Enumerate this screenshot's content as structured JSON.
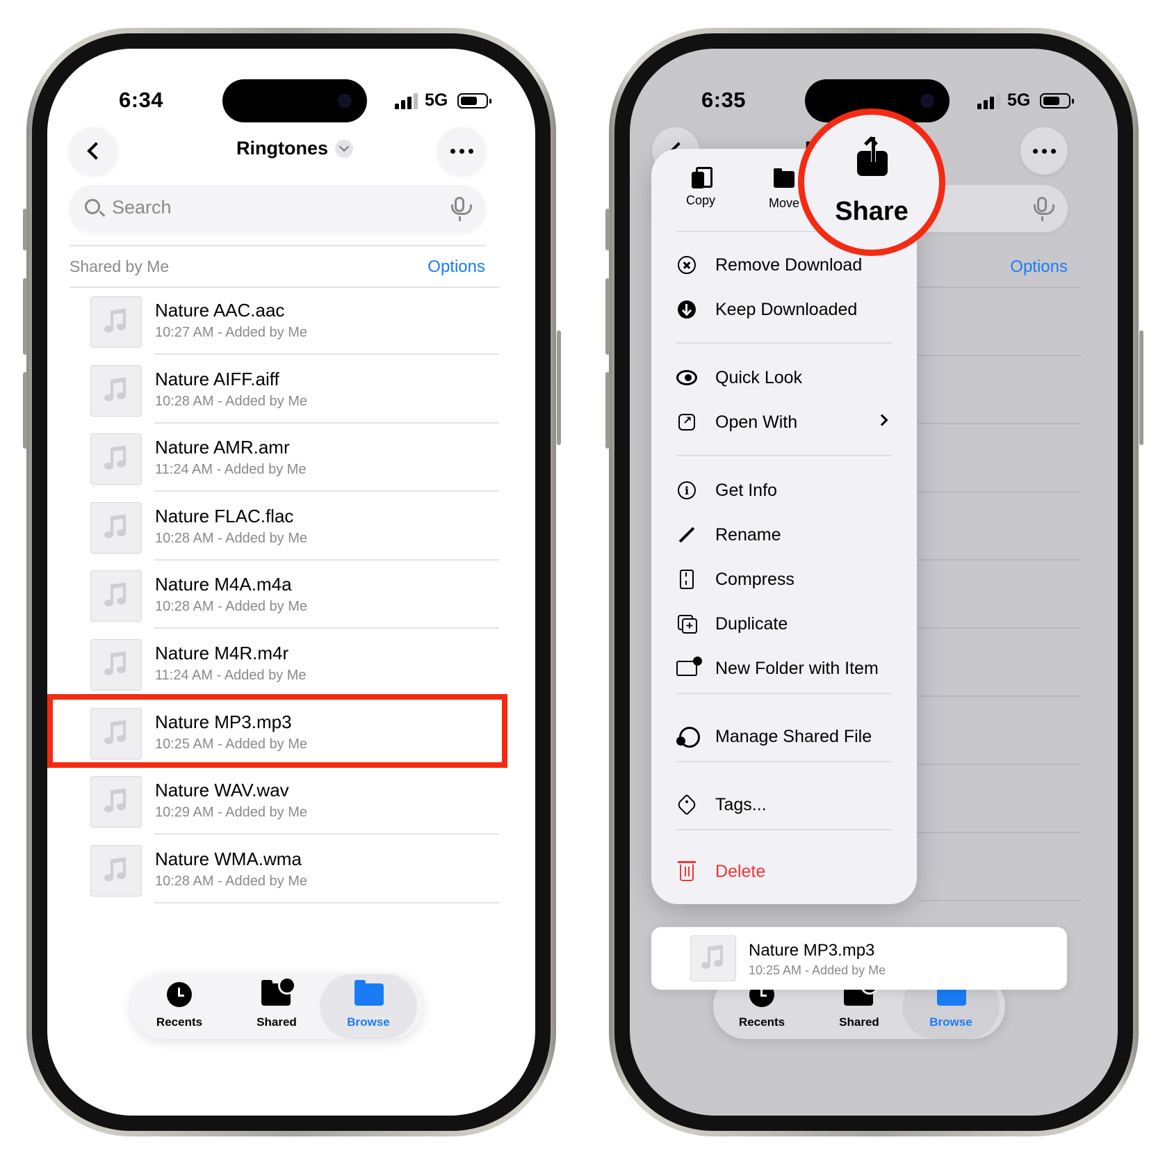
{
  "left": {
    "status": {
      "time": "6:34",
      "network": "5G"
    },
    "header": {
      "title": "Ringtones"
    },
    "search": {
      "placeholder": "Search"
    },
    "section": {
      "label": "Shared by Me",
      "options": "Options"
    },
    "files": [
      {
        "name": "Nature AAC.aac",
        "meta": "10:27 AM - Added by Me"
      },
      {
        "name": "Nature AIFF.aiff",
        "meta": "10:28 AM - Added by Me"
      },
      {
        "name": "Nature AMR.amr",
        "meta": "11:24 AM - Added by Me"
      },
      {
        "name": "Nature FLAC.flac",
        "meta": "10:28 AM - Added by Me"
      },
      {
        "name": "Nature M4A.m4a",
        "meta": "10:28 AM - Added by Me"
      },
      {
        "name": "Nature M4R.m4r",
        "meta": "11:24 AM - Added by Me"
      },
      {
        "name": "Nature MP3.mp3",
        "meta": "10:25 AM - Added by Me"
      },
      {
        "name": "Nature WAV.wav",
        "meta": "10:29 AM - Added by Me"
      },
      {
        "name": "Nature WMA.wma",
        "meta": "10:28 AM - Added by Me"
      }
    ],
    "highlighted_file_index": 6,
    "tabs": [
      {
        "label": "Recents",
        "icon": "clock-icon"
      },
      {
        "label": "Shared",
        "icon": "shared-folder-icon"
      },
      {
        "label": "Browse",
        "icon": "folder-icon",
        "active": true
      }
    ]
  },
  "right": {
    "status": {
      "time": "6:35",
      "network": "5G"
    },
    "header": {
      "title_partial": "R"
    },
    "section": {
      "options": "Options"
    },
    "menu": {
      "top_actions": [
        {
          "label": "Copy",
          "icon": "copy-icon"
        },
        {
          "label": "Move",
          "icon": "folder-icon"
        },
        {
          "label": "Share",
          "icon": "share-icon"
        }
      ],
      "items": [
        {
          "label": "Remove Download",
          "icon": "remove-download-icon"
        },
        {
          "label": "Keep Downloaded",
          "icon": "download-icon"
        },
        {
          "label": "Quick Look",
          "icon": "eye-icon"
        },
        {
          "label": "Open With",
          "icon": "open-with-icon"
        },
        {
          "label": "Get Info",
          "icon": "info-icon"
        },
        {
          "label": "Rename",
          "icon": "pencil-icon"
        },
        {
          "label": "Compress",
          "icon": "zip-icon"
        },
        {
          "label": "Duplicate",
          "icon": "duplicate-icon"
        },
        {
          "label": "New Folder with Item",
          "icon": "new-folder-icon"
        },
        {
          "label": "Manage Shared File",
          "icon": "shared-people-icon"
        },
        {
          "label": "Tags...",
          "icon": "tag-icon"
        },
        {
          "label": "Delete",
          "icon": "trash-icon"
        }
      ]
    },
    "preview": {
      "name": "Nature MP3.mp3",
      "meta": "10:25 AM - Added by Me"
    },
    "tabs": [
      {
        "label": "Recents"
      },
      {
        "label": "Shared"
      },
      {
        "label": "Browse",
        "active": true
      }
    ]
  },
  "colors": {
    "accent": "#1a7cf5",
    "highlight": "#f52a12",
    "danger": "#f0353b"
  }
}
